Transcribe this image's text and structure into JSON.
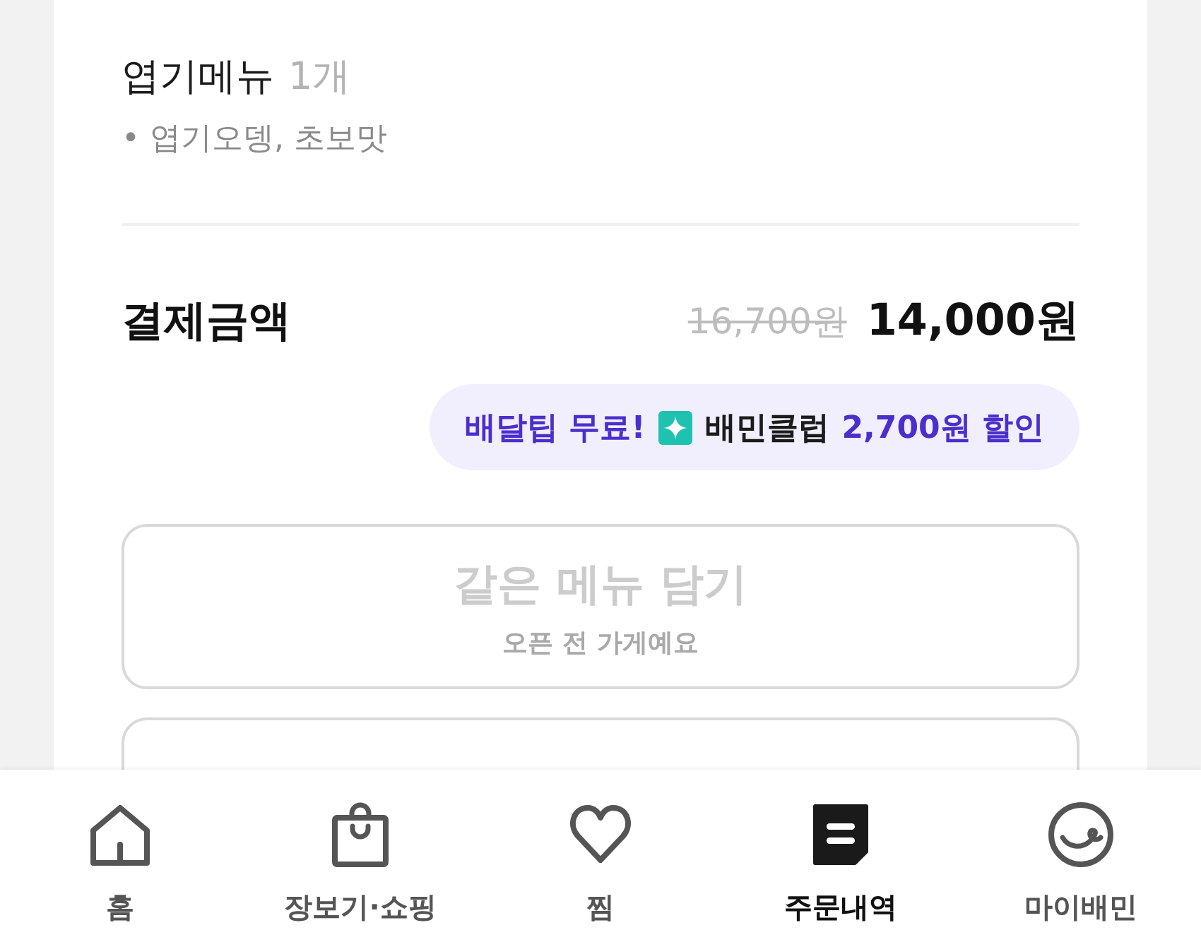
{
  "order_item": {
    "name": "엽기메뉴",
    "count": "1개",
    "options": "• 엽기오뎅, 초보맛"
  },
  "payment": {
    "label": "결제금액",
    "original_price": "16,700원",
    "final_price": "14,000원"
  },
  "promo": {
    "free_tip": "배달팁 무료!",
    "club_name": "배민클럽",
    "discount": "2,700원 할인"
  },
  "buttons": [
    {
      "kind": "labeled",
      "title": "같은 메뉴 담기",
      "subtitle": "오픈 전 가게예요",
      "disabled": true
    },
    {
      "kind": "outline"
    }
  ],
  "bottom_nav": [
    {
      "kind": "home",
      "label": "홈",
      "selected": false
    },
    {
      "kind": "shopping",
      "label": "장보기·쇼핑",
      "selected": false
    },
    {
      "kind": "heart",
      "label": "찜",
      "selected": false
    },
    {
      "kind": "orders",
      "label": "주문내역",
      "selected": true
    },
    {
      "kind": "my",
      "label": "마이배민",
      "selected": false
    }
  ]
}
